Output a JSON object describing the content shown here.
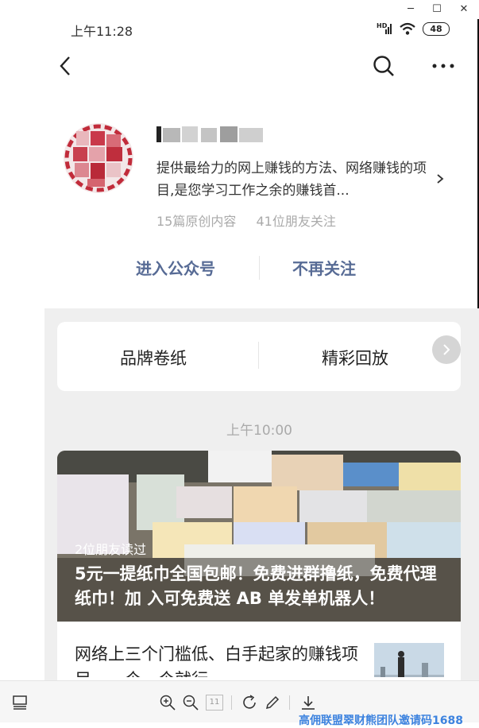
{
  "status_bar": {
    "time": "上午11:28",
    "network": "HD",
    "battery": "48"
  },
  "window_controls": {
    "minimize": "─",
    "maximize": "☐",
    "close": "✕"
  },
  "account": {
    "description": "提供最给力的网上赚钱的方法、网络赚钱的项目,是您学习工作之余的赚钱首...",
    "articles_count": "15篇原创内容",
    "followers": "41位朋友关注"
  },
  "actions": {
    "enter": "进入公众号",
    "unfollow": "不再关注"
  },
  "menu": {
    "items": [
      "品牌卷纸",
      "精彩回放"
    ]
  },
  "feed": {
    "time": "上午10:00",
    "article": {
      "read_by": "2位朋友读过",
      "title": "5元一提纸巾全国包邮！免费进群撸纸，免费代理纸巾！加 入可免费送 AB 单发单机器人！",
      "next_title": "网络上三个门槛低、白手起家的赚钱项目，一个一个就行"
    }
  },
  "toolbar": {
    "page": "11"
  },
  "watermark": "高佣联盟翠财熊团队邀请码1688",
  "colors": {
    "link_blue": "#576b95",
    "muted": "#aaaaaa",
    "watermark": "#3d83df"
  }
}
